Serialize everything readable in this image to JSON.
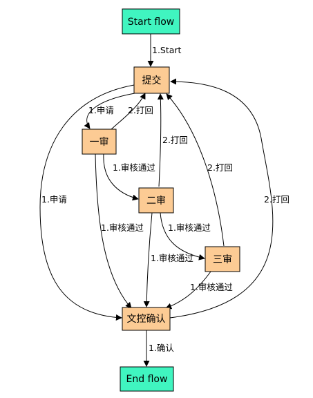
{
  "colors": {
    "terminal_fill": "#40f5c0",
    "step_fill": "#fccb94",
    "stroke": "#000000"
  },
  "nodes": {
    "start": "Start flow",
    "submit": "提交",
    "review1": "一审",
    "review2": "二审",
    "review3": "三审",
    "confirm": "文控确认",
    "end": "End flow"
  },
  "edges": {
    "start_to_submit": "1.Start",
    "submit_to_review1": "1.申请",
    "review1_to_submit": "2.打回",
    "review2_to_submit": "2.打回",
    "review3_to_submit": "2.打回",
    "confirm_to_submit": "2.打回",
    "submit_to_confirm": "1.申请",
    "review1_to_review2": "1.审核通过",
    "review1_to_confirm": "1.审核通过",
    "review2_to_review3": "1.审核通过",
    "review2_to_confirm": "1.审核通过",
    "review3_to_confirm": "1.审核通过",
    "confirm_to_end": "1.确认"
  }
}
